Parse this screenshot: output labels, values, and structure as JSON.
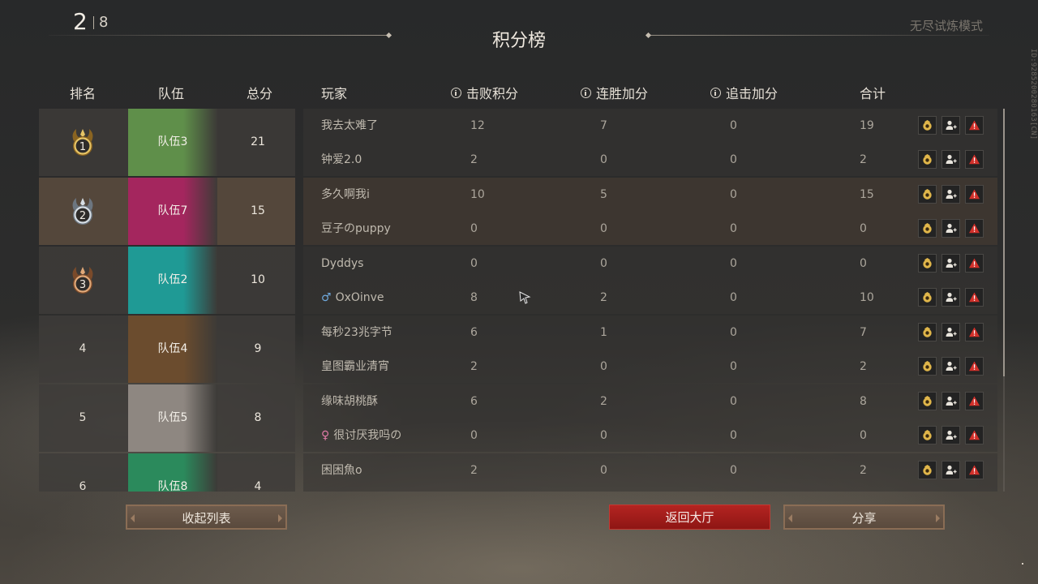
{
  "header": {
    "round_current": "2",
    "round_total": "8",
    "title": "积分榜",
    "mode": "无尽试炼模式",
    "side_id": "ID:9285200280163[CN]"
  },
  "columns": {
    "rank": "排名",
    "team": "队伍",
    "total_score": "总分",
    "player": "玩家",
    "defeat_points": "击败积分",
    "win_streak_bonus": "连胜加分",
    "pursuit_bonus": "追击加分",
    "sum": "合计"
  },
  "teams": [
    {
      "rank": "1",
      "medal": "gold",
      "name": "队伍3",
      "score": "21",
      "color": "#5f8f4a",
      "highlight": false,
      "players": [
        {
          "name": "我去太难了",
          "gender": "",
          "defeat": "12",
          "win": "7",
          "pursuit": "0",
          "total": "19"
        },
        {
          "name": "钟爱2.0",
          "gender": "",
          "defeat": "2",
          "win": "0",
          "pursuit": "0",
          "total": "2"
        }
      ]
    },
    {
      "rank": "2",
      "medal": "silver",
      "name": "队伍7",
      "score": "15",
      "color": "#a4265e",
      "highlight": true,
      "players": [
        {
          "name": "多久啊我i",
          "gender": "",
          "defeat": "10",
          "win": "5",
          "pursuit": "0",
          "total": "15"
        },
        {
          "name": "豆子のpuppy",
          "gender": "",
          "defeat": "0",
          "win": "0",
          "pursuit": "0",
          "total": "0"
        }
      ]
    },
    {
      "rank": "3",
      "medal": "bronze",
      "name": "队伍2",
      "score": "10",
      "color": "#1f9a95",
      "highlight": false,
      "players": [
        {
          "name": "Dyddys",
          "gender": "",
          "defeat": "0",
          "win": "0",
          "pursuit": "0",
          "total": "0"
        },
        {
          "name": "OxOinve",
          "gender": "♂",
          "defeat": "8",
          "win": "2",
          "pursuit": "0",
          "total": "10"
        }
      ]
    },
    {
      "rank": "4",
      "medal": "",
      "name": "队伍4",
      "score": "9",
      "color": "#6b4c2e",
      "highlight": false,
      "players": [
        {
          "name": "每秒23兆字节",
          "gender": "",
          "defeat": "6",
          "win": "1",
          "pursuit": "0",
          "total": "7"
        },
        {
          "name": "皇图霸业清宵",
          "gender": "",
          "defeat": "2",
          "win": "0",
          "pursuit": "0",
          "total": "2"
        }
      ]
    },
    {
      "rank": "5",
      "medal": "",
      "name": "队伍5",
      "score": "8",
      "color": "#8e8781",
      "highlight": false,
      "players": [
        {
          "name": "缘味胡桃酥",
          "gender": "",
          "defeat": "6",
          "win": "2",
          "pursuit": "0",
          "total": "8"
        },
        {
          "name": "很讨厌我吗の",
          "gender": "♀",
          "defeat": "0",
          "win": "0",
          "pursuit": "0",
          "total": "0"
        }
      ]
    },
    {
      "rank": "6",
      "medal": "",
      "name": "队伍8",
      "score": "4",
      "color": "#2b8a5c",
      "highlight": false,
      "players": [
        {
          "name": "困困魚o",
          "gender": "",
          "defeat": "2",
          "win": "0",
          "pursuit": "0",
          "total": "2"
        },
        {
          "name": "",
          "gender": "",
          "defeat": "",
          "win": "",
          "pursuit": "",
          "total": ""
        }
      ]
    }
  ],
  "icons": {
    "profile": "pouch-profile-icon",
    "add_friend": "add-friend-icon",
    "report": "report-warning-icon"
  },
  "buttons": {
    "collapse": "收起列表",
    "back_to_lobby": "返回大厅",
    "share": "分享"
  },
  "colors": {
    "accent_red": "#b42421",
    "button_brown": "#6d5b4c",
    "gold": "#c9a64a",
    "silver": "#b8c2cc",
    "bronze": "#c58a5c"
  }
}
